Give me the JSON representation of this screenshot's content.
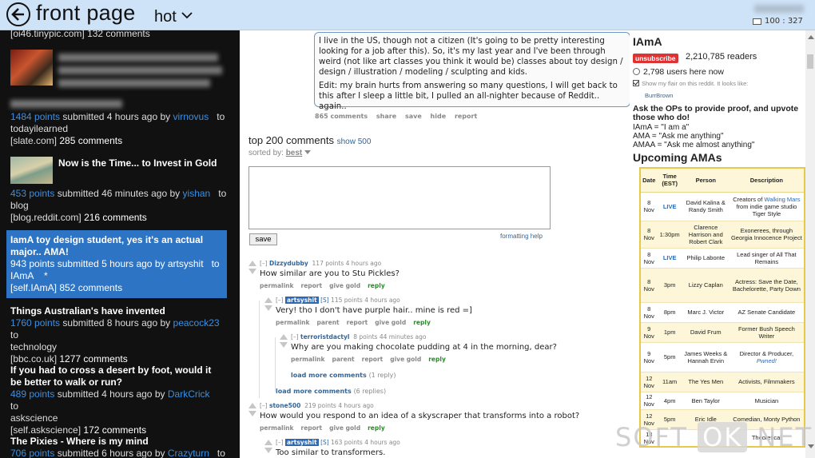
{
  "topbar": {
    "title": "front page",
    "sort": "hot",
    "status": "100 : 327"
  },
  "left_items": [
    {
      "domain": "[oi46.tinypic.com]",
      "comments": "132 comments"
    },
    {
      "points": "1484 points",
      "submitted": "submitted 4 hours ago",
      "by": "by",
      "user": "virnovus",
      "to": "to",
      "subreddit": "todayilearned",
      "domain": "[slate.com]",
      "comments": "285 comments"
    },
    {
      "title": "Now is the Time... to Invest in Gold",
      "points": "453 points",
      "submitted": "submitted 46 minutes ago",
      "by": "by",
      "user": "yishan",
      "to": "to",
      "subreddit": "blog",
      "domain": "[blog.reddit.com]",
      "comments": "216 comments"
    },
    {
      "title": "IamA toy design student, yes it's an actual major.. AMA!",
      "points": "943 points",
      "submitted": "submitted 5 hours ago",
      "by": "by",
      "user": "artsyshit",
      "to": "to",
      "subreddit": "IAmA",
      "star": "*",
      "domain": "[self.IAmA]",
      "comments": "852 comments"
    },
    {
      "title": "Things Australian's have invented",
      "points": "1760 points",
      "submitted": "submitted 8 hours ago",
      "by": "by",
      "user": "peacock23",
      "to": "to",
      "subreddit": "technology",
      "domain": "[bbc.co.uk]",
      "comments": "1277 comments"
    },
    {
      "title": "If you had to cross a desert by foot, would it be better to walk or run?",
      "points": "489 points",
      "submitted": "submitted 4 hours ago",
      "by": "by",
      "user": "DarkCrick",
      "to": "to",
      "subreddit": "askscience",
      "domain": "[self.askscience]",
      "comments": "172 comments"
    },
    {
      "title": "The Pixies - Where is my mind",
      "points": "706 points",
      "submitted": "submitted 6 hours ago",
      "by": "by",
      "user": "Crazyturn",
      "to": "to"
    }
  ],
  "post": {
    "selftext_p1": "I live in the US, though not a citizen (It's going to be pretty interesting looking for a job after this). So, it's my last year and I've been through weird (not like art classes you think it would be) classes about toy design / design / illustration / modeling / sculpting and kids.",
    "selftext_p2": "Edit: my brain hurts from answering so many questions, I will get back to this after I sleep a little bit, I pulled an all-nighter because of Reddit.. again..",
    "links": [
      "865 comments",
      "share",
      "save",
      "hide",
      "report"
    ]
  },
  "comments_header": {
    "title": "top 200 comments",
    "show": "show 500",
    "sorted_by": "sorted by:",
    "sort_value": "best",
    "save": "save",
    "formatting": "formatting help"
  },
  "comments": [
    {
      "toggle": "[–]",
      "author": "Dizzydubby",
      "score": "117 points 4 hours ago",
      "body": "How similar are you to Stu Pickles?",
      "links": [
        "permalink",
        "report",
        "give gold"
      ],
      "reply": "reply"
    },
    {
      "toggle": "[–]",
      "author": "artsyshit",
      "tag": "[S]",
      "score": "115 points 4 hours ago",
      "body": "Very! tho I don't have purple hair.. mine is red =]",
      "links": [
        "permalink",
        "parent",
        "report",
        "give gold"
      ],
      "reply": "reply"
    },
    {
      "toggle": "[–]",
      "author": "terroristdactyl",
      "score": "8 points 44 minutes ago",
      "body": "Why are you making chocolate pudding at 4 in the morning, dear?",
      "links": [
        "permalink",
        "parent",
        "report",
        "give gold"
      ],
      "reply": "reply"
    },
    {
      "toggle": "[–]",
      "author": "stone500",
      "score": "219 points 4 hours ago",
      "body": "How would you respond to an idea of a skyscraper that transforms into a robot?",
      "links": [
        "permalink",
        "report",
        "give gold"
      ],
      "reply": "reply"
    },
    {
      "toggle": "[–]",
      "author": "artsyshit",
      "tag": "[S]",
      "score": "163 points 4 hours ago",
      "body": "Too similar to transformers."
    }
  ],
  "load_more": [
    {
      "label": "load more comments",
      "count": "(1 reply)"
    },
    {
      "label": "load more comments",
      "count": "(6 replies)"
    }
  ],
  "sidebar": {
    "name": "IAmA",
    "unsubscribe": "unsubscribe",
    "readers": "2,210,785 readers",
    "online": "2,798 users here now",
    "flair": "Show my flair on this reddit. It looks like:",
    "flair_user": "BurrBrown",
    "ask": "Ask the OPs to provide proof, and upvote those who do!",
    "defs": [
      "IAmA = \"I am a\"",
      "AMA = \"Ask me anything\"",
      "AMAA = \"Ask me almost anything\""
    ],
    "upcoming": "Upcoming AMAs",
    "table_headers": [
      "Date",
      "Time (EST)",
      "Person",
      "Description"
    ],
    "rows": [
      {
        "date": "8 Nov",
        "time": "LIVE",
        "person": "David Kalina & Randy Smith",
        "desc_pre": "Creators of",
        "desc_link": "Walking Mars",
        "desc_post": "from indie game studio Tiger Style"
      },
      {
        "date": "8 Nov",
        "time": "1:30pm",
        "person": "Clarence Harrison and Robert Clark",
        "desc": "Exonerees, through Georgia Innocence Project"
      },
      {
        "date": "8 Nov",
        "time": "LIVE",
        "person": "Philip Labonte",
        "desc": "Lead singer of All That Remains"
      },
      {
        "date": "8 Nov",
        "time": "3pm",
        "person": "Lizzy Caplan",
        "desc": "Actress: Save the Date, Bachelorette, Party Down"
      },
      {
        "date": "8 Nov",
        "time": "8pm",
        "person": "Marc J. Victor",
        "desc": "AZ Senate Candidate"
      },
      {
        "date": "9 Nov",
        "time": "1pm",
        "person": "David Frum",
        "desc": "Former Bush Speech Writer"
      },
      {
        "date": "9 Nov",
        "time": "5pm",
        "person": "James Weeks & Hannah Ervin",
        "desc_pre": "Director & Producer,",
        "desc_link": "Pwned!"
      },
      {
        "date": "12 Nov",
        "time": "11am",
        "person": "The Yes Men",
        "desc": "Activists, Filmmakers"
      },
      {
        "date": "12 Nov",
        "time": "4pm",
        "person": "Ben Taylor",
        "desc": "Musician"
      },
      {
        "date": "12 Nov",
        "time": "5pm",
        "person": "Eric Idle",
        "desc": "Comedian, Monty Python"
      },
      {
        "date": "13 Nov",
        "time": "",
        "person": "",
        "desc": "Theoretical"
      }
    ]
  },
  "colors": {
    "topbar": "#cee3f8",
    "left_bg": "#111111",
    "selected": "#2d74c4",
    "link": "#336699",
    "op_badge": "#2f67b3",
    "unsubscribe": "#dd3333",
    "table_border": "#e6c84a"
  },
  "watermark": {
    "left": "SOFT",
    "ok": "OK",
    "right": "NET"
  }
}
